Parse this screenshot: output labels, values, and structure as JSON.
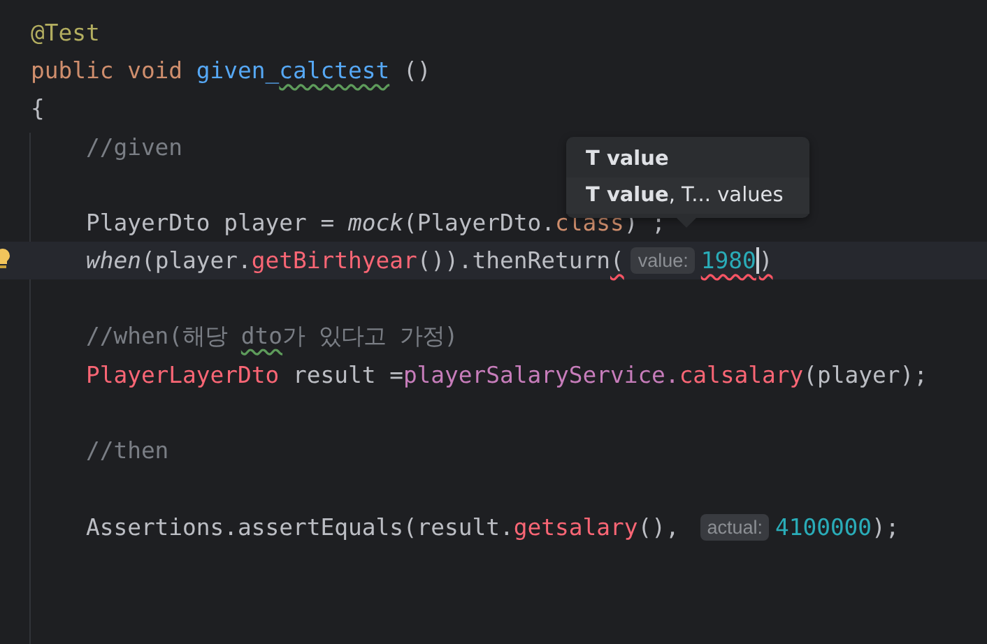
{
  "editor": {
    "lines": [
      {
        "kind": "code",
        "current": false,
        "bulb": false,
        "segments": [
          {
            "kind": "code",
            "tokens": [
              {
                "t": "@Test",
                "kind": "annotation"
              }
            ]
          }
        ]
      },
      {
        "kind": "code",
        "current": false,
        "bulb": false,
        "segments": [
          {
            "kind": "code",
            "tokens": [
              {
                "t": "public void ",
                "kind": "keyword"
              },
              {
                "t": "given_",
                "kind": "decl"
              },
              {
                "t": "calctest",
                "kind": "decl",
                "warning": true
              },
              {
                "t": " ()",
                "kind": "plain"
              }
            ]
          }
        ]
      },
      {
        "kind": "code",
        "current": false,
        "bulb": false,
        "segments": [
          {
            "kind": "code",
            "tokens": [
              {
                "t": "{",
                "kind": "plain"
              }
            ]
          }
        ]
      },
      {
        "kind": "code",
        "current": false,
        "bulb": false,
        "segments": [
          {
            "kind": "code",
            "tokens": [
              {
                "t": "    //given",
                "kind": "comment"
              }
            ]
          }
        ]
      },
      {
        "kind": "blank"
      },
      {
        "kind": "code",
        "current": false,
        "bulb": false,
        "segments": [
          {
            "kind": "code",
            "tokens": [
              {
                "t": "    PlayerDto player = ",
                "kind": "plain"
              },
              {
                "t": "mock",
                "kind": "italic"
              },
              {
                "t": "(PlayerDto.",
                "kind": "plain"
              },
              {
                "t": "class",
                "kind": "keyword"
              },
              {
                "t": ") ;",
                "kind": "plain"
              }
            ]
          }
        ]
      },
      {
        "kind": "code",
        "current": true,
        "bulb": true,
        "segments": [
          {
            "kind": "code",
            "tokens": [
              {
                "t": "    when",
                "kind": "italic"
              },
              {
                "t": "(player.",
                "kind": "plain"
              },
              {
                "t": "getBirthyear",
                "kind": "method"
              },
              {
                "t": "()).thenReturn",
                "kind": "plain"
              },
              {
                "t": "(",
                "kind": "plain",
                "error": true
              }
            ]
          },
          {
            "kind": "hint",
            "text": "value:"
          },
          {
            "kind": "code",
            "tokens": [
              {
                "t": "1980",
                "kind": "number",
                "error": true
              }
            ]
          },
          {
            "kind": "caret"
          },
          {
            "kind": "code",
            "tokens": [
              {
                "t": ")",
                "kind": "plain",
                "error": true
              }
            ]
          }
        ]
      },
      {
        "kind": "blank"
      },
      {
        "kind": "code",
        "current": false,
        "bulb": false,
        "segments": [
          {
            "kind": "code",
            "tokens": [
              {
                "t": "    //when(해당 ",
                "kind": "comment"
              },
              {
                "t": "dto",
                "kind": "comment",
                "warning": true
              },
              {
                "t": "가 있다고 가정)",
                "kind": "comment"
              }
            ]
          }
        ]
      },
      {
        "kind": "code",
        "current": false,
        "bulb": false,
        "segments": [
          {
            "kind": "code",
            "tokens": [
              {
                "t": "    PlayerLayerDto",
                "kind": "method"
              },
              {
                "t": " result =",
                "kind": "plain"
              },
              {
                "t": "playerSalaryService.",
                "kind": "field"
              },
              {
                "t": "calsalary",
                "kind": "method"
              },
              {
                "t": "(player);",
                "kind": "plain"
              }
            ]
          }
        ]
      },
      {
        "kind": "blank"
      },
      {
        "kind": "code",
        "current": false,
        "bulb": false,
        "segments": [
          {
            "kind": "code",
            "tokens": [
              {
                "t": "    //then",
                "kind": "comment"
              }
            ]
          }
        ]
      },
      {
        "kind": "blank"
      },
      {
        "kind": "code",
        "current": false,
        "bulb": false,
        "segments": [
          {
            "kind": "code",
            "tokens": [
              {
                "t": "    Assertions.assertEquals(result.",
                "kind": "plain"
              },
              {
                "t": "getsalary",
                "kind": "method"
              },
              {
                "t": "(), ",
                "kind": "plain"
              }
            ]
          },
          {
            "kind": "hint",
            "text": "actual:"
          },
          {
            "kind": "code",
            "tokens": [
              {
                "t": "4100000",
                "kind": "number"
              },
              {
                "t": ");",
                "kind": "plain"
              }
            ]
          }
        ]
      }
    ]
  },
  "param_popup": {
    "items": [
      {
        "main": "T value"
      },
      {
        "main": "T value",
        "rest": ", T... values"
      }
    ]
  }
}
